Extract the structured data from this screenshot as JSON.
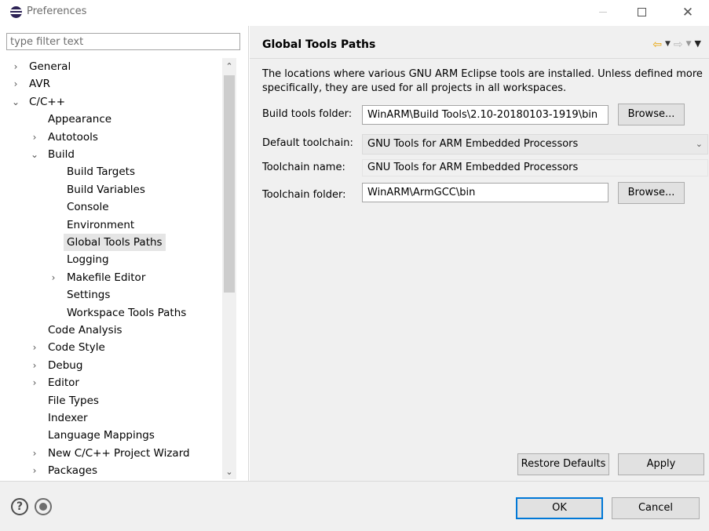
{
  "window": {
    "title": "Preferences",
    "close_glyph": "✕"
  },
  "filter": {
    "placeholder": "type filter text"
  },
  "tree": {
    "items": [
      {
        "label": "General",
        "arrow": "›"
      },
      {
        "label": "AVR",
        "arrow": "›"
      },
      {
        "label": "C/C++",
        "arrow": "⌄"
      },
      {
        "label": "Appearance",
        "arrow": ""
      },
      {
        "label": "Autotools",
        "arrow": "›"
      },
      {
        "label": "Build",
        "arrow": "⌄"
      },
      {
        "label": "Build Targets",
        "arrow": ""
      },
      {
        "label": "Build Variables",
        "arrow": ""
      },
      {
        "label": "Console",
        "arrow": ""
      },
      {
        "label": "Environment",
        "arrow": ""
      },
      {
        "label": "Global Tools Paths",
        "arrow": "",
        "selected": true
      },
      {
        "label": "Logging",
        "arrow": ""
      },
      {
        "label": "Makefile Editor",
        "arrow": "›"
      },
      {
        "label": "Settings",
        "arrow": ""
      },
      {
        "label": "Workspace Tools Paths",
        "arrow": ""
      },
      {
        "label": "Code Analysis",
        "arrow": ""
      },
      {
        "label": "Code Style",
        "arrow": "›"
      },
      {
        "label": "Debug",
        "arrow": "›"
      },
      {
        "label": "Editor",
        "arrow": "›"
      },
      {
        "label": "File Types",
        "arrow": ""
      },
      {
        "label": "Indexer",
        "arrow": ""
      },
      {
        "label": "Language Mappings",
        "arrow": ""
      },
      {
        "label": "New C/C++ Project Wizard",
        "arrow": "›"
      },
      {
        "label": "Packages",
        "arrow": "›"
      }
    ]
  },
  "page": {
    "title": "Global Tools Paths",
    "description": "The locations where various GNU ARM Eclipse tools are installed. Unless defined more specifically, they are used for all projects in all workspaces.",
    "build_tools_label": "Build tools folder:",
    "build_tools_value": "WinARM\\Build Tools\\2.10-20180103-1919\\bin",
    "default_toolchain_label": "Default toolchain:",
    "default_toolchain_value": "GNU Tools for ARM Embedded Processors",
    "toolchain_name_label": "Toolchain name:",
    "toolchain_name_value": "GNU Tools for ARM Embedded Processors",
    "toolchain_folder_label": "Toolchain folder:",
    "toolchain_folder_value": "WinARM\\ArmGCC\\bin",
    "browse_label": "Browse...",
    "restore_defaults_label": "Restore Defaults",
    "apply_label": "Apply"
  },
  "footer": {
    "ok_label": "OK",
    "cancel_label": "Cancel",
    "help_glyph": "?"
  },
  "icons": {
    "back": "⇦",
    "forward": "⇨",
    "dropdown": "▼",
    "menu": "▼",
    "scroll_up": "⌃",
    "scroll_down": "⌄"
  }
}
